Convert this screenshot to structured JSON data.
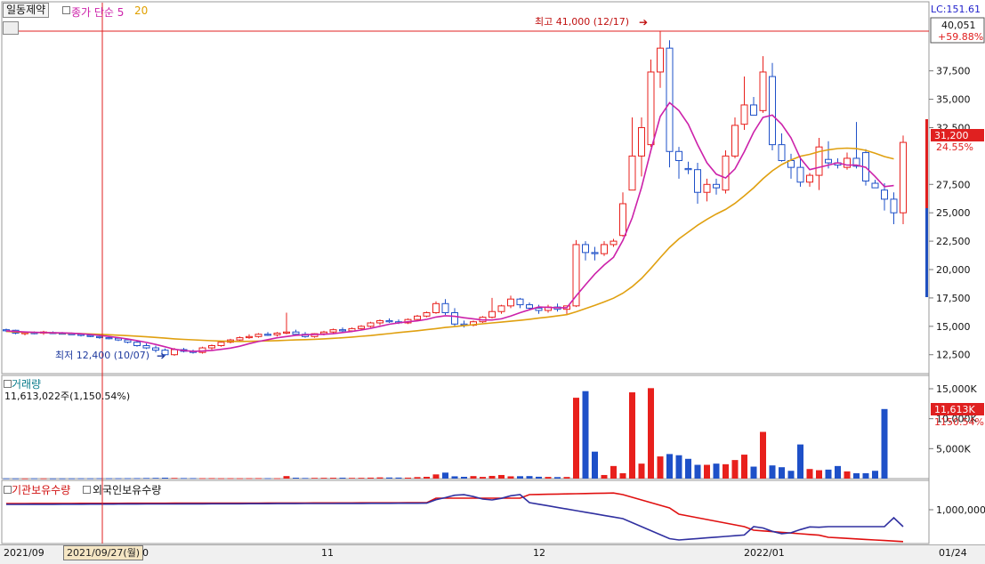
{
  "header": {
    "stock_name": "일동제약",
    "ma5_label": "종가 단순 5",
    "ma20_label": "20"
  },
  "price_panel": {
    "high_label": "최고 41,000 (12/17)",
    "low_label": "최저 12,400 (10/07)",
    "lc_label": "LC:151.61",
    "max_box_value": "40,051",
    "max_box_pct": "+59.88%",
    "current_price": "31,200",
    "current_pct": "24.55%",
    "y_ticks": [
      "37,500",
      "35,000",
      "32,500",
      "27,500",
      "25,000",
      "22,500",
      "20,000",
      "17,500",
      "15,000",
      "12,500"
    ]
  },
  "volume_panel": {
    "title": "거래량",
    "subtitle": "11,613,022주(1,150.54%)",
    "current_value": "11,613K",
    "current_pct": "1150.54%",
    "y_ticks": [
      "15,000K",
      "10,000K",
      "5,000K"
    ]
  },
  "holding_panel": {
    "inst_title": "기관보유수량",
    "foreign_title": "외국인보유수량",
    "y_tick": "1,000,000"
  },
  "x_axis": {
    "labels": [
      "2021/09",
      "0",
      "11",
      "12",
      "2022/01",
      "01/24"
    ],
    "crosshair_date": "2021/09/27(월)"
  },
  "colors": {
    "up": "#e8201c",
    "down": "#1e50c8",
    "ma5": "#cc22aa",
    "ma20": "#e0a010",
    "inst": "#e01010",
    "foreign": "#3030a0",
    "crosshair": "#e02020"
  },
  "chart_data": {
    "type": "candlestick",
    "price_range": [
      11500,
      40500
    ],
    "volume_range_k": [
      0,
      16000
    ],
    "candles": [
      {
        "o": 14700,
        "h": 14800,
        "l": 14500,
        "c": 14650
      },
      {
        "o": 14650,
        "h": 14700,
        "l": 14300,
        "c": 14400
      },
      {
        "o": 14350,
        "h": 14500,
        "l": 14200,
        "c": 14450
      },
      {
        "o": 14450,
        "h": 14550,
        "l": 14300,
        "c": 14350
      },
      {
        "o": 14400,
        "h": 14600,
        "l": 14250,
        "c": 14500
      },
      {
        "o": 14450,
        "h": 14550,
        "l": 14350,
        "c": 14400
      },
      {
        "o": 14400,
        "h": 14500,
        "l": 14300,
        "c": 14350
      },
      {
        "o": 14350,
        "h": 14450,
        "l": 14250,
        "c": 14300
      },
      {
        "o": 14300,
        "h": 14400,
        "l": 14100,
        "c": 14200
      },
      {
        "o": 14200,
        "h": 14350,
        "l": 14050,
        "c": 14100
      },
      {
        "o": 14100,
        "h": 14200,
        "l": 13900,
        "c": 14000
      },
      {
        "o": 14000,
        "h": 14100,
        "l": 13850,
        "c": 13950
      },
      {
        "o": 13950,
        "h": 14050,
        "l": 13700,
        "c": 13800
      },
      {
        "o": 13800,
        "h": 13900,
        "l": 13500,
        "c": 13600
      },
      {
        "o": 13600,
        "h": 13700,
        "l": 13200,
        "c": 13300
      },
      {
        "o": 13300,
        "h": 13500,
        "l": 13000,
        "c": 13100
      },
      {
        "o": 13100,
        "h": 13300,
        "l": 12700,
        "c": 12900
      },
      {
        "o": 12900,
        "h": 13050,
        "l": 12400,
        "c": 12500
      },
      {
        "o": 12500,
        "h": 13100,
        "l": 12400,
        "c": 12950
      },
      {
        "o": 12950,
        "h": 13100,
        "l": 12700,
        "c": 12800
      },
      {
        "o": 12800,
        "h": 12950,
        "l": 12600,
        "c": 12700
      },
      {
        "o": 12700,
        "h": 13200,
        "l": 12600,
        "c": 13100
      },
      {
        "o": 13100,
        "h": 13400,
        "l": 12900,
        "c": 13300
      },
      {
        "o": 13300,
        "h": 13700,
        "l": 13200,
        "c": 13600
      },
      {
        "o": 13600,
        "h": 13900,
        "l": 13500,
        "c": 13800
      },
      {
        "o": 13800,
        "h": 14100,
        "l": 13700,
        "c": 14000
      },
      {
        "o": 14000,
        "h": 14300,
        "l": 13900,
        "c": 14100
      },
      {
        "o": 14100,
        "h": 14400,
        "l": 14000,
        "c": 14300
      },
      {
        "o": 14300,
        "h": 14500,
        "l": 14150,
        "c": 14250
      },
      {
        "o": 14250,
        "h": 14500,
        "l": 14100,
        "c": 14400
      },
      {
        "o": 14400,
        "h": 16200,
        "l": 14300,
        "c": 14500
      },
      {
        "o": 14500,
        "h": 14700,
        "l": 14200,
        "c": 14300
      },
      {
        "o": 14300,
        "h": 14500,
        "l": 14000,
        "c": 14100
      },
      {
        "o": 14100,
        "h": 14400,
        "l": 14000,
        "c": 14350
      },
      {
        "o": 14350,
        "h": 14600,
        "l": 14200,
        "c": 14500
      },
      {
        "o": 14500,
        "h": 14800,
        "l": 14350,
        "c": 14700
      },
      {
        "o": 14700,
        "h": 14900,
        "l": 14500,
        "c": 14600
      },
      {
        "o": 14600,
        "h": 14900,
        "l": 14500,
        "c": 14800
      },
      {
        "o": 14800,
        "h": 15100,
        "l": 14700,
        "c": 15000
      },
      {
        "o": 15000,
        "h": 15400,
        "l": 14900,
        "c": 15300
      },
      {
        "o": 15300,
        "h": 15600,
        "l": 15100,
        "c": 15500
      },
      {
        "o": 15500,
        "h": 15700,
        "l": 15300,
        "c": 15400
      },
      {
        "o": 15400,
        "h": 15600,
        "l": 15200,
        "c": 15300
      },
      {
        "o": 15300,
        "h": 15700,
        "l": 15200,
        "c": 15600
      },
      {
        "o": 15600,
        "h": 16000,
        "l": 15500,
        "c": 15900
      },
      {
        "o": 15900,
        "h": 16300,
        "l": 15800,
        "c": 16200
      },
      {
        "o": 16200,
        "h": 17200,
        "l": 16100,
        "c": 17000
      },
      {
        "o": 17000,
        "h": 17400,
        "l": 16000,
        "c": 16200
      },
      {
        "o": 16200,
        "h": 16600,
        "l": 15000,
        "c": 15200
      },
      {
        "o": 15200,
        "h": 15500,
        "l": 14900,
        "c": 15100
      },
      {
        "o": 15100,
        "h": 15500,
        "l": 15000,
        "c": 15400
      },
      {
        "o": 15400,
        "h": 15900,
        "l": 15300,
        "c": 15800
      },
      {
        "o": 15800,
        "h": 17500,
        "l": 15700,
        "c": 16300
      },
      {
        "o": 16300,
        "h": 16900,
        "l": 16100,
        "c": 16800
      },
      {
        "o": 16800,
        "h": 17700,
        "l": 16600,
        "c": 17400
      },
      {
        "o": 17400,
        "h": 17500,
        "l": 16600,
        "c": 16900
      },
      {
        "o": 16900,
        "h": 17100,
        "l": 16400,
        "c": 16600
      },
      {
        "o": 16600,
        "h": 16900,
        "l": 16100,
        "c": 16400
      },
      {
        "o": 16400,
        "h": 16900,
        "l": 16200,
        "c": 16700
      },
      {
        "o": 16700,
        "h": 17000,
        "l": 16300,
        "c": 16500
      },
      {
        "o": 16500,
        "h": 16800,
        "l": 16000,
        "c": 16800
      },
      {
        "o": 16800,
        "h": 22600,
        "l": 16700,
        "c": 22200
      },
      {
        "o": 22200,
        "h": 22500,
        "l": 20800,
        "c": 21500
      },
      {
        "o": 21500,
        "h": 22000,
        "l": 20800,
        "c": 21400
      },
      {
        "o": 21400,
        "h": 22500,
        "l": 21200,
        "c": 22200
      },
      {
        "o": 22200,
        "h": 22700,
        "l": 22000,
        "c": 22500
      },
      {
        "o": 23000,
        "h": 26800,
        "l": 22900,
        "c": 25800
      },
      {
        "o": 27000,
        "h": 33400,
        "l": 27000,
        "c": 30000
      },
      {
        "o": 30000,
        "h": 33400,
        "l": 28200,
        "c": 32500
      },
      {
        "o": 31000,
        "h": 38500,
        "l": 30800,
        "c": 37400
      },
      {
        "o": 37400,
        "h": 41000,
        "l": 36000,
        "c": 39500
      },
      {
        "o": 39500,
        "h": 40200,
        "l": 29000,
        "c": 30400
      },
      {
        "o": 30400,
        "h": 30800,
        "l": 28000,
        "c": 29600
      },
      {
        "o": 28900,
        "h": 29500,
        "l": 28400,
        "c": 28800
      },
      {
        "o": 28800,
        "h": 29400,
        "l": 25800,
        "c": 26800
      },
      {
        "o": 26800,
        "h": 28000,
        "l": 26000,
        "c": 27500
      },
      {
        "o": 27500,
        "h": 28000,
        "l": 26600,
        "c": 27200
      },
      {
        "o": 27000,
        "h": 30500,
        "l": 26700,
        "c": 30000
      },
      {
        "o": 30000,
        "h": 33400,
        "l": 29800,
        "c": 32700
      },
      {
        "o": 32800,
        "h": 37000,
        "l": 32300,
        "c": 34500
      },
      {
        "o": 34500,
        "h": 35200,
        "l": 33600,
        "c": 33600
      },
      {
        "o": 34000,
        "h": 38800,
        "l": 33800,
        "c": 37400
      },
      {
        "o": 37000,
        "h": 38200,
        "l": 30500,
        "c": 31000
      },
      {
        "o": 31000,
        "h": 32000,
        "l": 29500,
        "c": 29600
      },
      {
        "o": 29600,
        "h": 30200,
        "l": 28000,
        "c": 29000
      },
      {
        "o": 29000,
        "h": 30000,
        "l": 27300,
        "c": 27700
      },
      {
        "o": 27700,
        "h": 28500,
        "l": 27300,
        "c": 28300
      },
      {
        "o": 28300,
        "h": 31600,
        "l": 27000,
        "c": 30800
      },
      {
        "o": 29700,
        "h": 31300,
        "l": 28900,
        "c": 29400
      },
      {
        "o": 29400,
        "h": 29800,
        "l": 28900,
        "c": 29200
      },
      {
        "o": 29000,
        "h": 30300,
        "l": 28800,
        "c": 29800
      },
      {
        "o": 29800,
        "h": 33000,
        "l": 28900,
        "c": 29100
      },
      {
        "o": 30300,
        "h": 30600,
        "l": 27400,
        "c": 27800
      },
      {
        "o": 27600,
        "h": 27900,
        "l": 27200,
        "c": 27200
      },
      {
        "o": 27000,
        "h": 27600,
        "l": 25200,
        "c": 26200
      },
      {
        "o": 26200,
        "h": 26800,
        "l": 24000,
        "c": 25000
      },
      {
        "o": 25000,
        "h": 31800,
        "l": 24000,
        "c": 31200
      }
    ],
    "volume_k": [
      40,
      35,
      30,
      45,
      38,
      30,
      35,
      40,
      50,
      45,
      60,
      55,
      60,
      70,
      80,
      100,
      120,
      150,
      110,
      90,
      80,
      70,
      80,
      60,
      70,
      60,
      70,
      80,
      70,
      60,
      420,
      150,
      100,
      120,
      130,
      140,
      150,
      120,
      130,
      160,
      200,
      180,
      170,
      160,
      250,
      300,
      700,
      1000,
      380,
      300,
      420,
      280,
      450,
      600,
      380,
      400,
      420,
      310,
      280,
      250,
      270,
      13500,
      14600,
      4500,
      600,
      2100,
      900,
      14400,
      2500,
      15100,
      3700,
      4100,
      3900,
      3300,
      2300,
      2300,
      2500,
      2400,
      3100,
      4000,
      2000,
      7800,
      2200,
      1900,
      1300,
      5700,
      1600,
      1400,
      1500,
      2100,
      1200,
      900,
      900,
      1300,
      11613
    ],
    "ma5": [
      14600,
      14550,
      14500,
      14470,
      14450,
      14430,
      14420,
      14390,
      14340,
      14280,
      14200,
      14110,
      14010,
      13880,
      13740,
      13580,
      13400,
      13200,
      12980,
      12860,
      12800,
      12820,
      12880,
      12970,
      13080,
      13250,
      13470,
      13660,
      13830,
      13990,
      14100,
      14210,
      14260,
      14290,
      14300,
      14350,
      14450,
      14550,
      14670,
      14820,
      15000,
      15180,
      15310,
      15400,
      15480,
      15610,
      15820,
      15930,
      15880,
      15750,
      15660,
      15560,
      15560,
      15660,
      15900,
      16200,
      16460,
      16700,
      16660,
      16640,
      16640,
      17680,
      18660,
      19600,
      20400,
      21080,
      22560,
      24550,
      27240,
      30500,
      33480,
      34700,
      34000,
      32800,
      31000,
      29400,
      28400,
      28060,
      28860,
      30380,
      32100,
      33400,
      33600,
      32800,
      31600,
      29800,
      28800,
      29000,
      29200,
      29400,
      29200,
      29200,
      29000,
      28200,
      27300,
      27400
    ],
    "ma20": [
      14550,
      14500,
      14470,
      14460,
      14440,
      14420,
      14400,
      14380,
      14360,
      14330,
      14300,
      14260,
      14220,
      14180,
      14130,
      14080,
      14020,
      13960,
      13900,
      13850,
      13810,
      13770,
      13730,
      13700,
      13680,
      13670,
      13680,
      13700,
      13720,
      13740,
      13770,
      13800,
      13830,
      13860,
      13900,
      13940,
      13990,
      14050,
      14120,
      14190,
      14270,
      14360,
      14450,
      14530,
      14610,
      14700,
      14800,
      14900,
      14980,
      15060,
      15140,
      15220,
      15300,
      15370,
      15450,
      15530,
      15620,
      15720,
      15820,
      15920,
      16030,
      16280,
      16560,
      16840,
      17150,
      17480,
      17920,
      18500,
      19220,
      20100,
      21050,
      21950,
      22700,
      23300,
      23900,
      24420,
      24890,
      25300,
      25830,
      26500,
      27200,
      28000,
      28700,
      29250,
      29650,
      29980,
      30150,
      30380,
      30550,
      30660,
      30700,
      30650,
      30500,
      30250,
      29950,
      29750
    ]
  }
}
